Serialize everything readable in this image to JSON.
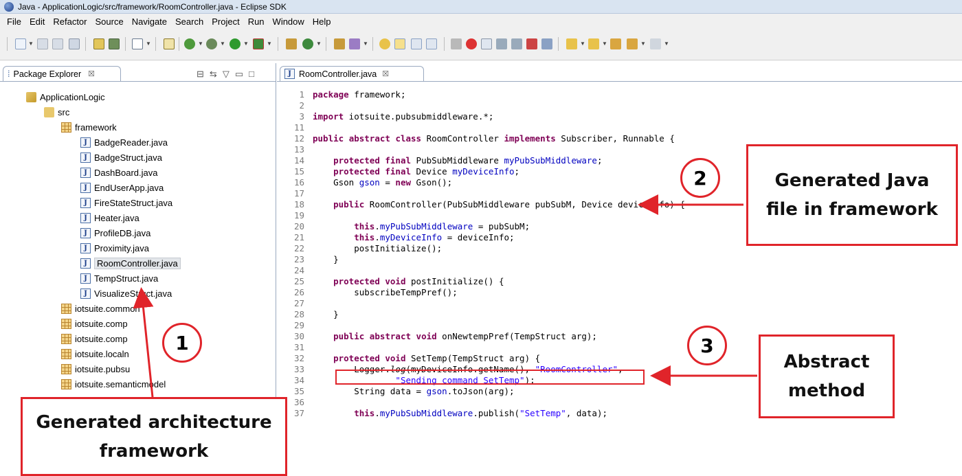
{
  "window": {
    "title": "Java - ApplicationLogic/src/framework/RoomController.java - Eclipse SDK"
  },
  "menu": [
    "File",
    "Edit",
    "Refactor",
    "Source",
    "Navigate",
    "Search",
    "Project",
    "Run",
    "Window",
    "Help"
  ],
  "explorer": {
    "tab_label": "Package Explorer",
    "tab_close": "☒",
    "tree": {
      "project": "ApplicationLogic",
      "src": "src",
      "framework": "framework",
      "files": [
        "BadgeReader.java",
        "BadgeStruct.java",
        "DashBoard.java",
        "EndUserApp.java",
        "FireStateStruct.java",
        "Heater.java",
        "ProfileDB.java",
        "Proximity.java",
        "RoomController.java",
        "TempStruct.java",
        "VisualizeStruct.java"
      ],
      "selected_file": "RoomController.java",
      "packages": [
        "iotsuite.common",
        "iotsuite.comp",
        "iotsuite.comp",
        "iotsuite.localn",
        "iotsuite.pubsu",
        "iotsuite.semanticmodel"
      ]
    }
  },
  "editor": {
    "tab_label": "RoomController.java",
    "tab_close": "☒",
    "lines": [
      {
        "num": "1",
        "text": "package framework;"
      },
      {
        "num": "2",
        "text": ""
      },
      {
        "num": "3",
        "text": "import iotsuite.pubsubmiddleware.*;"
      },
      {
        "num": "11",
        "text": ""
      },
      {
        "num": "12",
        "text": "public abstract class RoomController implements Subscriber, Runnable {"
      },
      {
        "num": "13",
        "text": ""
      },
      {
        "num": "14",
        "text": "    protected final PubSubMiddleware myPubSubMiddleware;"
      },
      {
        "num": "15",
        "text": "    protected final Device myDeviceInfo;"
      },
      {
        "num": "16",
        "text": "    Gson gson = new Gson();"
      },
      {
        "num": "17",
        "text": ""
      },
      {
        "num": "18",
        "text": "    public RoomController(PubSubMiddleware pubSubM, Device deviceInfo) {"
      },
      {
        "num": "19",
        "text": ""
      },
      {
        "num": "20",
        "text": "        this.myPubSubMiddleware = pubSubM;"
      },
      {
        "num": "21",
        "text": "        this.myDeviceInfo = deviceInfo;"
      },
      {
        "num": "22",
        "text": "        postInitialize();"
      },
      {
        "num": "23",
        "text": "    }"
      },
      {
        "num": "24",
        "text": ""
      },
      {
        "num": "25",
        "text": "    protected void postInitialize() {"
      },
      {
        "num": "26",
        "text": "        subscribeTempPref();"
      },
      {
        "num": "27",
        "text": ""
      },
      {
        "num": "28",
        "text": "    }"
      },
      {
        "num": "29",
        "text": ""
      },
      {
        "num": "30",
        "text": "    public abstract void onNewtempPref(TempStruct arg);"
      },
      {
        "num": "31",
        "text": ""
      },
      {
        "num": "32",
        "text": "    protected void SetTemp(TempStruct arg) {"
      },
      {
        "num": "33",
        "text": "        Logger.log(myDeviceInfo.getName(), \"RoomController\","
      },
      {
        "num": "34",
        "text": "                \"Sending command SetTemp\");"
      },
      {
        "num": "35",
        "text": "        String data = gson.toJson(arg);"
      },
      {
        "num": "36",
        "text": ""
      },
      {
        "num": "37",
        "text": "        this.myPubSubMiddleware.publish(\"SetTemp\", data);"
      }
    ]
  },
  "annotations": {
    "circle_1": "1",
    "circle_2": "2",
    "circle_3": "3",
    "callout_java_file": "Generated Java file in framework",
    "callout_abstract": "Abstract method",
    "callout_architecture": "Generated architecture framework",
    "color": "#e0242a"
  }
}
